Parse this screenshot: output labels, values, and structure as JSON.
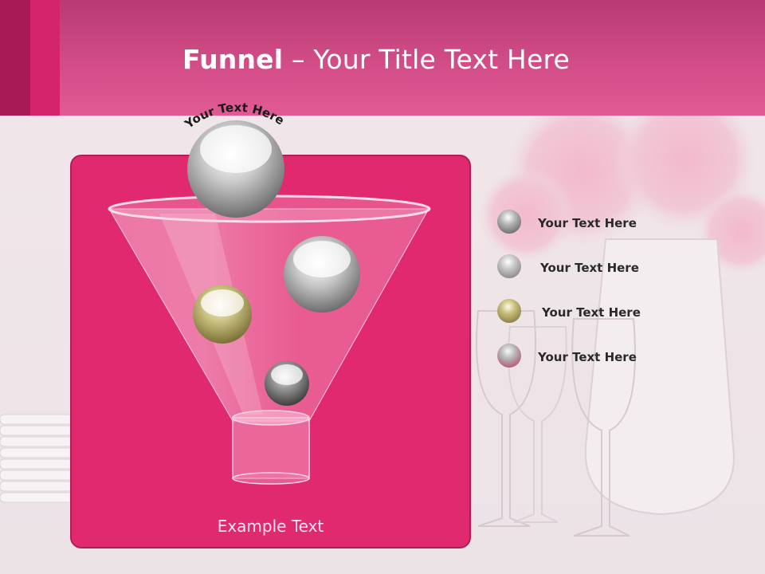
{
  "slide": {
    "title_bold": "Funnel",
    "title_rest": " – Your Title Text Here",
    "arc_text": "Your Text Here",
    "example_text": "Example Text"
  },
  "legend": [
    {
      "label": "Your  Text Here",
      "color": "#6a6a6a"
    },
    {
      "label": "Your  Text Here",
      "color": "#8a8a8a"
    },
    {
      "label": "Your  Text Here",
      "color": "#a39a5a"
    },
    {
      "label": "Your  Text Here",
      "color": "#c0406e"
    }
  ],
  "colors": {
    "header": "#d24d88",
    "panel": "#e0296f",
    "accent_dark": "#a81a55"
  }
}
